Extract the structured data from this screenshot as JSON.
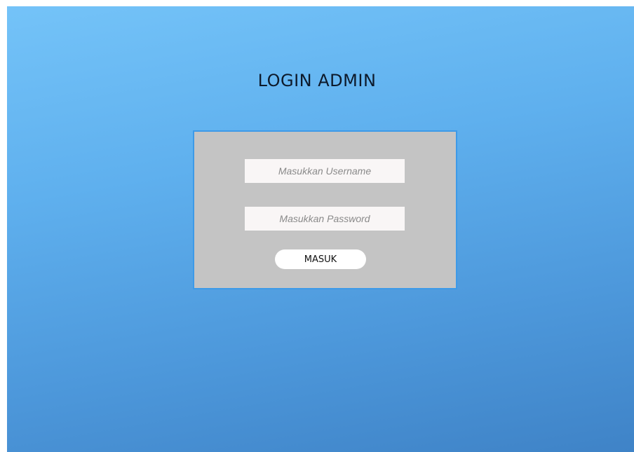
{
  "page": {
    "title": "LOGIN ADMIN",
    "background_colors": [
      "#74c3f8",
      "#3f83c7"
    ]
  },
  "login_form": {
    "username_placeholder": "Masukkan Username",
    "username_value": "",
    "password_placeholder": "Masukkan Password",
    "password_value": "",
    "submit_label": "MASUK",
    "panel_color": "#c4c4c4",
    "border_color": "#3d9ae8"
  }
}
